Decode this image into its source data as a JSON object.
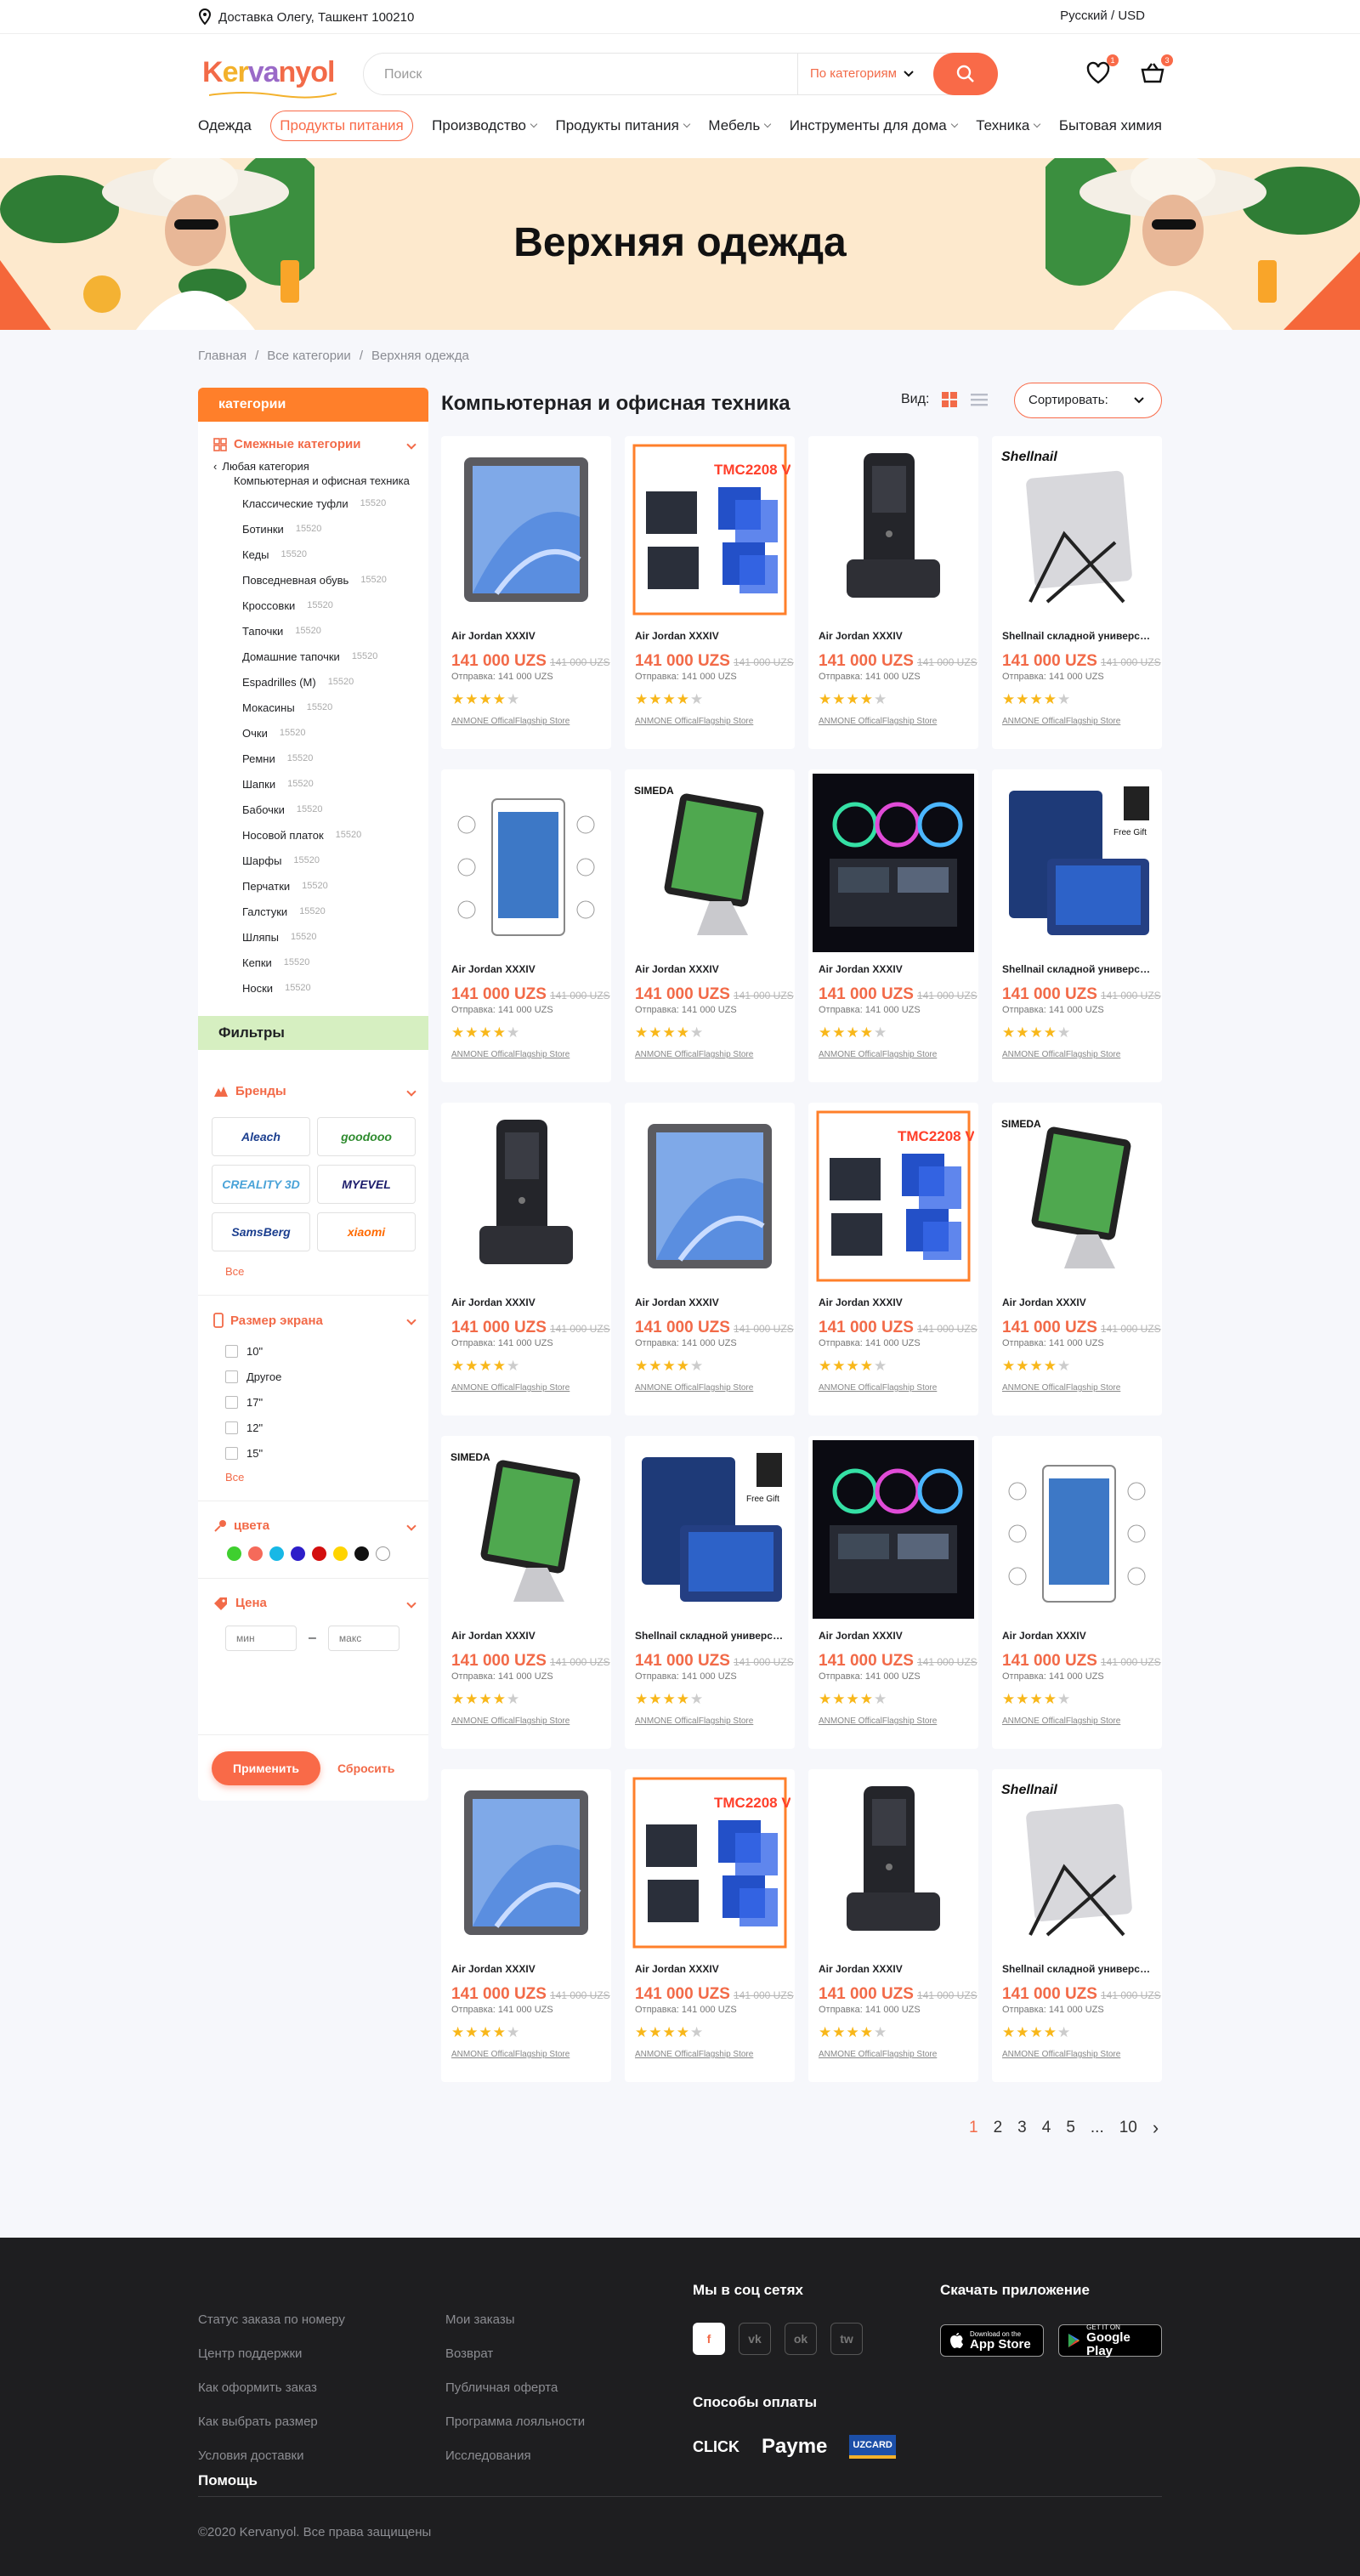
{
  "topbar": {
    "delivery": "Доставка Олегу, Ташкент 100210",
    "lang": "Русский / USD"
  },
  "header": {
    "logo": "Kervanyol",
    "search_placeholder": "Поиск",
    "category_select": "По категориям",
    "wishlist_count": "1",
    "cart_count": "3"
  },
  "nav": [
    {
      "label": "Одежда",
      "caret": false,
      "active": false
    },
    {
      "label": "Продукты питания",
      "caret": false,
      "active": true
    },
    {
      "label": "Производство",
      "caret": true,
      "active": false
    },
    {
      "label": "Продукты питания",
      "caret": true,
      "active": false
    },
    {
      "label": "Мебель",
      "caret": true,
      "active": false
    },
    {
      "label": "Инструменты для дома",
      "caret": true,
      "active": false
    },
    {
      "label": "Техника",
      "caret": true,
      "active": false
    },
    {
      "label": "Бытовая химия",
      "caret": false,
      "active": false
    }
  ],
  "banner": {
    "title": "Верхняя одежда"
  },
  "breadcrumbs": [
    "Главная",
    "Все категории",
    "Верхняя одежда"
  ],
  "sidebar": {
    "header": "категории",
    "related_title": "Смежные категории",
    "any_category": "Любая категория",
    "current_category": "Компьютерная и офисная техника",
    "categories": [
      {
        "name": "Классические туфли",
        "count": "15520"
      },
      {
        "name": "Ботинки",
        "count": "15520"
      },
      {
        "name": "Кеды",
        "count": "15520"
      },
      {
        "name": "Повседневная обувь",
        "count": "15520"
      },
      {
        "name": "Кроссовки",
        "count": "15520"
      },
      {
        "name": "Тапочки",
        "count": "15520"
      },
      {
        "name": "Домашние тапочки",
        "count": "15520"
      },
      {
        "name": "Espadrilles (M)",
        "count": "15520"
      },
      {
        "name": "Мокасины",
        "count": "15520"
      },
      {
        "name": "Очки",
        "count": "15520"
      },
      {
        "name": "Ремни",
        "count": "15520"
      },
      {
        "name": "Шапки",
        "count": "15520"
      },
      {
        "name": "Бабочки",
        "count": "15520"
      },
      {
        "name": "Носовой платок",
        "count": "15520"
      },
      {
        "name": "Шарфы",
        "count": "15520"
      },
      {
        "name": "Перчатки",
        "count": "15520"
      },
      {
        "name": "Галстуки",
        "count": "15520"
      },
      {
        "name": "Шляпы",
        "count": "15520"
      },
      {
        "name": "Кепки",
        "count": "15520"
      },
      {
        "name": "Носки",
        "count": "15520"
      }
    ],
    "filters_title": "Фильтры",
    "brands_title": "Бренды",
    "brands": [
      {
        "name": "Aleach",
        "color": "#1c3f8f"
      },
      {
        "name": "goodooo",
        "color": "#2e8b2e"
      },
      {
        "name": "CREALITY 3D",
        "color": "#4aa3d8"
      },
      {
        "name": "MYEVEL",
        "color": "#1c1c6b"
      },
      {
        "name": "SamsBerg",
        "color": "#1c3f8f"
      },
      {
        "name": "xiaomi",
        "color": "#ff6a00"
      }
    ],
    "brands_all": "Все",
    "screen_title": "Размер экрана",
    "screen_sizes": [
      "10\"",
      "Другое",
      "17\"",
      "12\"",
      "15\""
    ],
    "screen_all": "Все",
    "colors_title": "цвета",
    "colors": [
      "#3fcf2f",
      "#f56a5a",
      "#17b8e6",
      "#2d1ec9",
      "#d30f0f",
      "#ffd400",
      "#111111",
      "#ffffff"
    ],
    "price_title": "Цена",
    "price_min_placeholder": "мин",
    "price_max_placeholder": "макс",
    "apply": "Применить",
    "reset": "Сбросить"
  },
  "products_title": "Компьютерная и офисная техника",
  "view_label": "Вид:",
  "sort_label": "Сортировать:",
  "products": [
    {
      "img": "tablet",
      "name": "Air Jordan XXXIV",
      "price": "141 000 UZS",
      "old_price": "141 000 UZS",
      "shipping": "Отправка: 141 000 UZS",
      "rating": 4,
      "store": "ANMONE OfficalFlagship Store"
    },
    {
      "img": "board",
      "name": "Air Jordan XXXIV",
      "price": "141 000 UZS",
      "old_price": "141 000 UZS",
      "shipping": "Отправка: 141 000 UZS",
      "rating": 4,
      "store": "ANMONE OfficalFlagship Store"
    },
    {
      "img": "scanner",
      "name": "Air Jordan XXXIV",
      "price": "141 000 UZS",
      "old_price": "141 000 UZS",
      "shipping": "Отправка: 141 000 UZS",
      "rating": 4,
      "store": "ANMONE OfficalFlagship Store"
    },
    {
      "img": "stand",
      "name": "Shellnail складной универсальный",
      "price": "141 000 UZS",
      "old_price": "141 000 UZS",
      "shipping": "Отправка: 141 000 UZS",
      "rating": 4,
      "store": "ANMONE OfficalFlagship Store"
    },
    {
      "img": "tabwhite",
      "name": "Air Jordan XXXIV",
      "price": "141 000 UZS",
      "old_price": "141 000 UZS",
      "shipping": "Отправка: 141 000 UZS",
      "rating": 4,
      "store": "ANMONE OfficalFlagship Store"
    },
    {
      "img": "ipadstand",
      "name": "Air Jordan XXXIV",
      "price": "141 000 UZS",
      "old_price": "141 000 UZS",
      "shipping": "Отправка: 141 000 UZS",
      "rating": 4,
      "store": "ANMONE OfficalFlagship Store"
    },
    {
      "img": "cooler",
      "name": "Air Jordan XXXIV",
      "price": "141 000 UZS",
      "old_price": "141 000 UZS",
      "shipping": "Отправка: 141 000 UZS",
      "rating": 4,
      "store": "ANMONE OfficalFlagship Store"
    },
    {
      "img": "case",
      "name": "Shellnail складной универсальный",
      "price": "141 000 UZS",
      "old_price": "141 000 UZS",
      "shipping": "Отправка: 141 000 UZS",
      "rating": 4,
      "store": "ANMONE OfficalFlagship Store"
    },
    {
      "img": "scanner",
      "name": "Air Jordan XXXIV",
      "price": "141 000 UZS",
      "old_price": "141 000 UZS",
      "shipping": "Отправка: 141 000 UZS",
      "rating": 4,
      "store": "ANMONE OfficalFlagship Store"
    },
    {
      "img": "tablet",
      "name": "Air Jordan XXXIV",
      "price": "141 000 UZS",
      "old_price": "141 000 UZS",
      "shipping": "Отправка: 141 000 UZS",
      "rating": 4,
      "store": "ANMONE OfficalFlagship Store"
    },
    {
      "img": "board",
      "name": "Air Jordan XXXIV",
      "price": "141 000 UZS",
      "old_price": "141 000 UZS",
      "shipping": "Отправка: 141 000 UZS",
      "rating": 4,
      "store": "ANMONE OfficalFlagship Store"
    },
    {
      "img": "ipadstand",
      "name": "Air Jordan XXXIV",
      "price": "141 000 UZS",
      "old_price": "141 000 UZS",
      "shipping": "Отправка: 141 000 UZS",
      "rating": 4,
      "store": "ANMONE OfficalFlagship Store"
    },
    {
      "img": "ipadstand",
      "name": "Air Jordan XXXIV",
      "price": "141 000 UZS",
      "old_price": "141 000 UZS",
      "shipping": "Отправка: 141 000 UZS",
      "rating": 4,
      "store": "ANMONE OfficalFlagship Store"
    },
    {
      "img": "case",
      "name": "Shellnail складной универсальный",
      "price": "141 000 UZS",
      "old_price": "141 000 UZS",
      "shipping": "Отправка: 141 000 UZS",
      "rating": 4,
      "store": "ANMONE OfficalFlagship Store"
    },
    {
      "img": "cooler",
      "name": "Air Jordan XXXIV",
      "price": "141 000 UZS",
      "old_price": "141 000 UZS",
      "shipping": "Отправка: 141 000 UZS",
      "rating": 4,
      "store": "ANMONE OfficalFlagship Store"
    },
    {
      "img": "tabwhite",
      "name": "Air Jordan XXXIV",
      "price": "141 000 UZS",
      "old_price": "141 000 UZS",
      "shipping": "Отправка: 141 000 UZS",
      "rating": 4,
      "store": "ANMONE OfficalFlagship Store"
    },
    {
      "img": "tablet",
      "name": "Air Jordan XXXIV",
      "price": "141 000 UZS",
      "old_price": "141 000 UZS",
      "shipping": "Отправка: 141 000 UZS",
      "rating": 4,
      "store": "ANMONE OfficalFlagship Store"
    },
    {
      "img": "board",
      "name": "Air Jordan XXXIV",
      "price": "141 000 UZS",
      "old_price": "141 000 UZS",
      "shipping": "Отправка: 141 000 UZS",
      "rating": 4,
      "store": "ANMONE OfficalFlagship Store"
    },
    {
      "img": "scanner",
      "name": "Air Jordan XXXIV",
      "price": "141 000 UZS",
      "old_price": "141 000 UZS",
      "shipping": "Отправка: 141 000 UZS",
      "rating": 4,
      "store": "ANMONE OfficalFlagship Store"
    },
    {
      "img": "stand",
      "name": "Shellnail складной универсальный",
      "price": "141 000 UZS",
      "old_price": "141 000 UZS",
      "shipping": "Отправка: 141 000 UZS",
      "rating": 4,
      "store": "ANMONE OfficalFlagship Store"
    }
  ],
  "pagination": {
    "pages": [
      "1",
      "2",
      "3",
      "4",
      "5",
      "...",
      "10"
    ],
    "current": "1"
  },
  "footer": {
    "col1": [
      "Статус заказа по номеру",
      "Центр поддержки",
      "Как оформить заказ",
      "Как выбрать размер",
      "Условия доставки"
    ],
    "col2": [
      "Мои заказы",
      "Возврат",
      "Публичная оферта",
      "Программа лояльности",
      "Исследования"
    ],
    "help": "Помощь",
    "social_title": "Мы в соц сетях",
    "socials": [
      "f",
      "vk",
      "ok",
      "tw"
    ],
    "payments_title": "Способы оплаты",
    "payments": [
      "CLICK",
      "Payme",
      "UZCARD"
    ],
    "app_title": "Скачать приложение",
    "appstore_small": "Download on the",
    "appstore_big": "App Store",
    "gplay_small": "GET IT ON",
    "gplay_big": "Google Play",
    "copyright": "©2020 Kervanyol. Все права защищены"
  }
}
